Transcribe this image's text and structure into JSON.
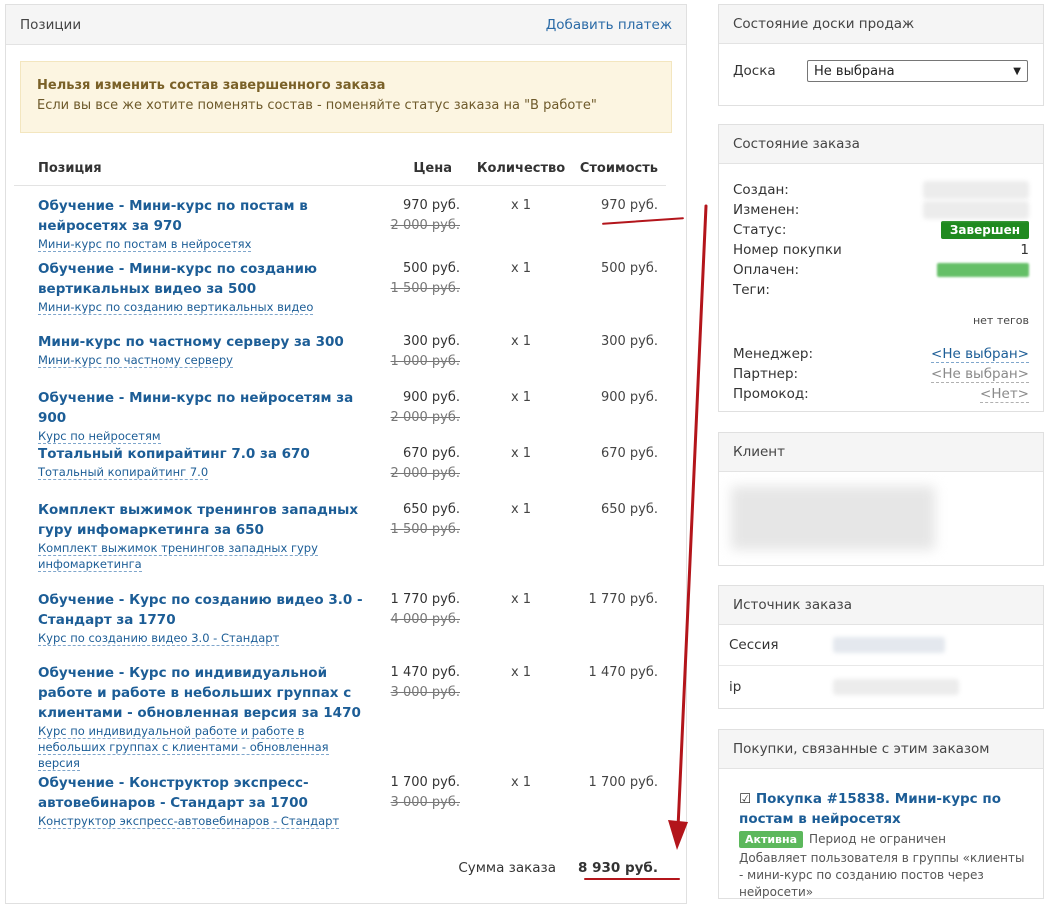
{
  "positions_panel": {
    "title": "Позиции",
    "add_payment": "Добавить платеж",
    "warning_title": "Нельзя изменить состав завершенного заказа",
    "warning_text": "Если вы все же хотите поменять состав - поменяйте статус заказа на \"В работе\"",
    "headers": {
      "name": "Позиция",
      "price": "Цена",
      "qty": "Количество",
      "cost": "Стоимость"
    },
    "items": [
      {
        "title": "Обучение - Мини-курс по постам в нейросетях за 970",
        "sub": "Мини-курс по постам в нейросетях",
        "price": "970 руб.",
        "old": "2 000 руб.",
        "qty": "x 1",
        "cost": "970 руб."
      },
      {
        "title": "Обучение - Мини-курс по созданию вертикальных видео за 500",
        "sub": "Мини-курс по созданию вертикальных видео",
        "price": "500 руб.",
        "old": "1 500 руб.",
        "qty": "x 1",
        "cost": "500 руб."
      },
      {
        "title": "Мини-курс по частному серверу за 300",
        "sub": "Мини-курс по частному серверу",
        "price": "300 руб.",
        "old": "1 000 руб.",
        "qty": "x 1",
        "cost": "300 руб."
      },
      {
        "title": "Обучение - Мини-курс по нейросетям за 900",
        "sub": "Курс по нейросетям",
        "price": "900 руб.",
        "old": "2 000 руб.",
        "qty": "x 1",
        "cost": "900 руб."
      },
      {
        "title": "Тотальный копирайтинг 7.0 за 670",
        "sub": "Тотальный копирайтинг 7.0",
        "price": "670 руб.",
        "old": "2 000 руб.",
        "qty": "x 1",
        "cost": "670 руб."
      },
      {
        "title": "Комплект выжимок тренингов западных гуру инфомаркетинга за 650",
        "sub": "Комплект выжимок тренингов западных гуру инфомаркетинга",
        "price": "650 руб.",
        "old": "1 500 руб.",
        "qty": "x 1",
        "cost": "650 руб."
      },
      {
        "title": "Обучение - Курс по созданию видео 3.0 - Стандарт за 1770",
        "sub": "Курс по созданию видео 3.0 - Стандарт",
        "price": "1 770 руб.",
        "old": "4 000 руб.",
        "qty": "x 1",
        "cost": "1 770 руб."
      },
      {
        "title": "Обучение - Курс по индивидуальной работе и работе в небольших группах с клиентами - обновленная версия за 1470",
        "sub": "Курс по индивидуальной работе и работе в небольших группах с клиентами - обновленная версия",
        "price": "1 470 руб.",
        "old": "3 000 руб.",
        "qty": "x 1",
        "cost": "1 470 руб."
      },
      {
        "title": "Обучение - Конструктор экспресс-автовебинаров - Стандарт за 1700",
        "sub": "Конструктор экспресс-автовебинаров - Стандарт",
        "price": "1 700 руб.",
        "old": "3 000 руб.",
        "qty": "x 1",
        "cost": "1 700 руб."
      }
    ],
    "sum_label": "Сумма заказа",
    "sum_value": "8 930 руб."
  },
  "board_panel": {
    "title": "Состояние доски продаж",
    "label": "Доска",
    "selected": "Не выбрана"
  },
  "order_panel": {
    "title": "Состояние заказа",
    "created_label": "Создан:",
    "changed_label": "Изменен:",
    "status_label": "Статус:",
    "status_value": "Завершен",
    "purchase_num_label": "Номер покупки",
    "purchase_num_value": "1",
    "paid_label": "Оплачен:",
    "tags_label": "Теги:",
    "tags_empty": "нет тегов",
    "manager_label": "Менеджер:",
    "manager_value": "<Не выбран>",
    "partner_label": "Партнер:",
    "partner_value": "<Не выбран>",
    "promo_label": "Промокод:",
    "promo_value": "<Нет>"
  },
  "client_panel": {
    "title": "Клиент"
  },
  "source_panel": {
    "title": "Источник заказа",
    "session_label": "Сессия",
    "ip_label": "ip"
  },
  "purchases_panel": {
    "title": "Покупки, связанные с этим заказом",
    "purchase_title": "Покупка #15838. Мини-курс по постам в нейросетях",
    "status": "Активна",
    "period": "Период не ограничен",
    "desc": "Добавляет пользователя в группы «клиенты - мини-курс по созданию постов через нейросети»"
  }
}
